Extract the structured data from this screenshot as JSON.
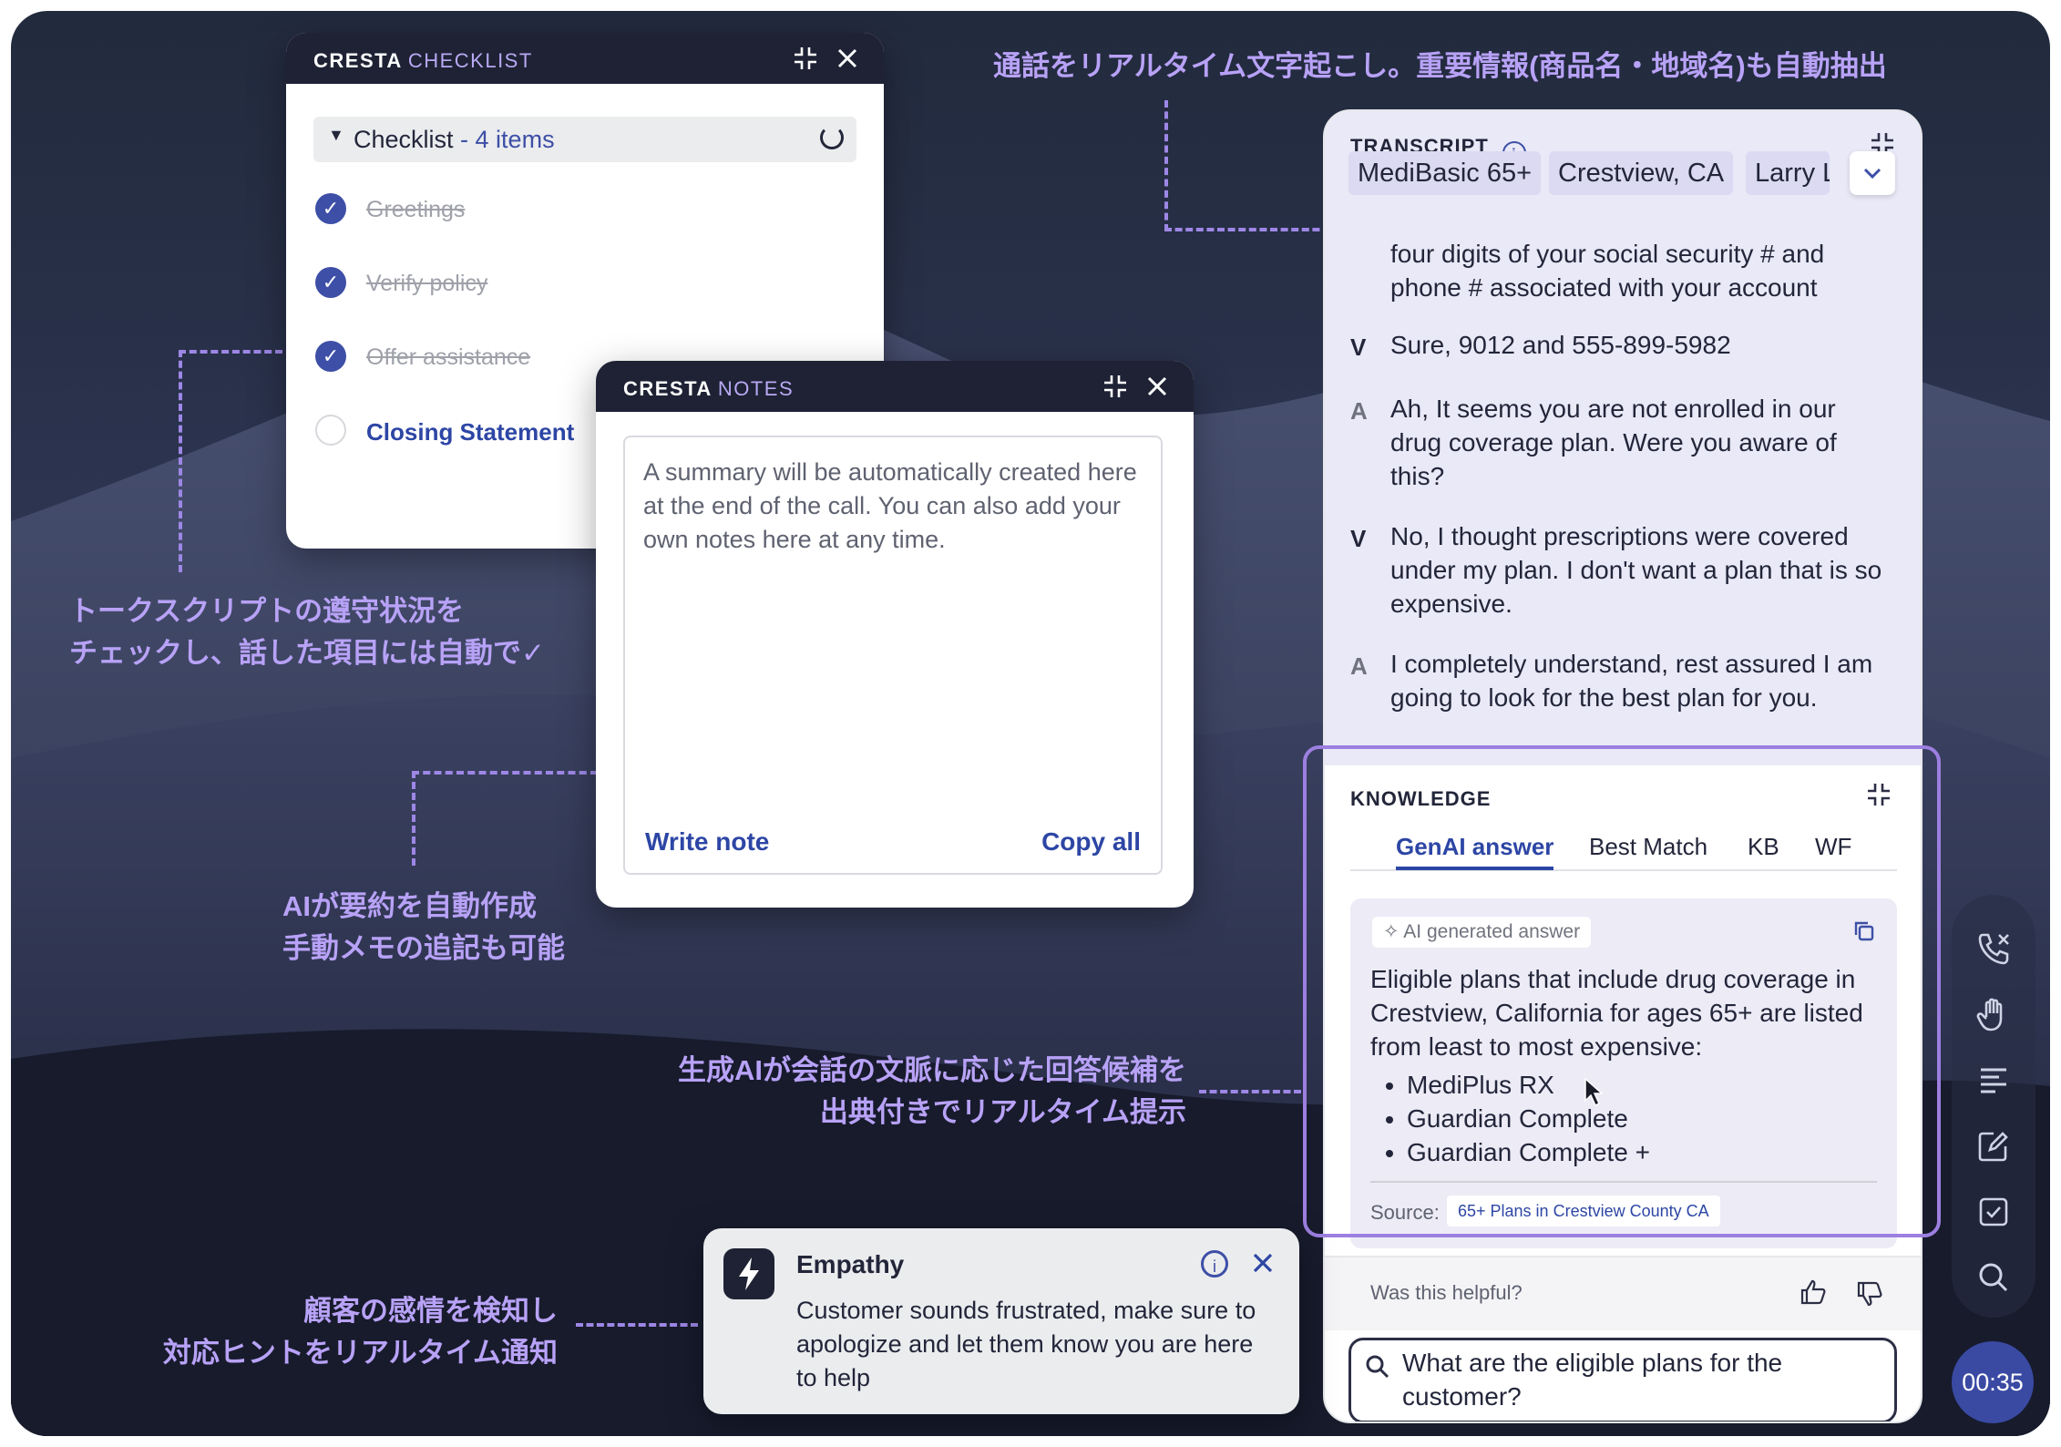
{
  "annotations": {
    "transcript": "通話をリアルタイム文字起こし。重要情報(商品名・地域名)も自動抽出",
    "checklist_line1": "トークスクリプトの遵守状況を",
    "checklist_line2": "チェックし、話した項目には自動で✓",
    "notes_line1": "AIが要約を自動作成",
    "notes_line2": "手動メモの追記も可能",
    "knowledge_line1": "生成AIが会話の文脈に応じた回答候補を",
    "knowledge_line2": "出典付きでリアルタイム提示",
    "empathy_line1": "顧客の感情を検知し",
    "empathy_line2": "対応ヒントをリアルタイム通知"
  },
  "checklist": {
    "brand": "CRESTA",
    "title": "CHECKLIST",
    "header_label": "Checklist",
    "header_count": "- 4 items",
    "items": [
      {
        "label": "Greetings",
        "done": true
      },
      {
        "label": "Verify policy",
        "done": true
      },
      {
        "label": "Offer assistance",
        "done": true
      },
      {
        "label": "Closing Statement",
        "done": false
      }
    ]
  },
  "notes": {
    "brand": "CRESTA",
    "title": "NOTES",
    "placeholder": "A summary will be automatically created here at the end of the call. You can also add your own notes here at any time.",
    "write_note": "Write note",
    "copy_all": "Copy all"
  },
  "transcript": {
    "title": "TRANSCRIPT",
    "chips": [
      "MediBasic 65+",
      "Crestview, CA",
      "Larry L"
    ],
    "lines": [
      {
        "speaker": "",
        "text": "four digits of your social security # and phone # associated with your account"
      },
      {
        "speaker": "V",
        "text": "Sure, 9012 and 555-899-5982"
      },
      {
        "speaker": "A",
        "text": "Ah, It seems you are not enrolled in our drug coverage plan. Were you aware of this?"
      },
      {
        "speaker": "V",
        "text": "No, I thought prescriptions were covered under my plan. I don't want a plan that is so expensive."
      },
      {
        "speaker": "A",
        "text": "I completely understand, rest assured I am going to look for the best plan for you."
      }
    ]
  },
  "knowledge": {
    "title": "KNOWLEDGE",
    "tabs": [
      "GenAI answer",
      "Best Match",
      "KB",
      "WF"
    ],
    "active_tab": "GenAI answer",
    "ai_badge": "AI generated answer",
    "answer": "Eligible plans that include drug coverage in Crestview, California for ages 65+ are listed from least to most expensive:",
    "bullets": [
      "MediPlus RX",
      "Guardian Complete",
      "Guardian Complete +"
    ],
    "source_label": "Source:",
    "source_value": "65+ Plans in Crestview County CA",
    "helpful": "Was this helpful?",
    "search_text": "What are the eligible plans for the customer?"
  },
  "empathy": {
    "title": "Empathy",
    "body": "Customer sounds frustrated, make sure to apologize and let them know you are here to help"
  },
  "timer": "00:35",
  "colors": {
    "brand_accent": "#b9a9f4",
    "annotation": "#b8a2f7",
    "check": "#3d4fa6",
    "link": "#2d46a5",
    "knowledge_highlight": "#9c7fe0"
  }
}
